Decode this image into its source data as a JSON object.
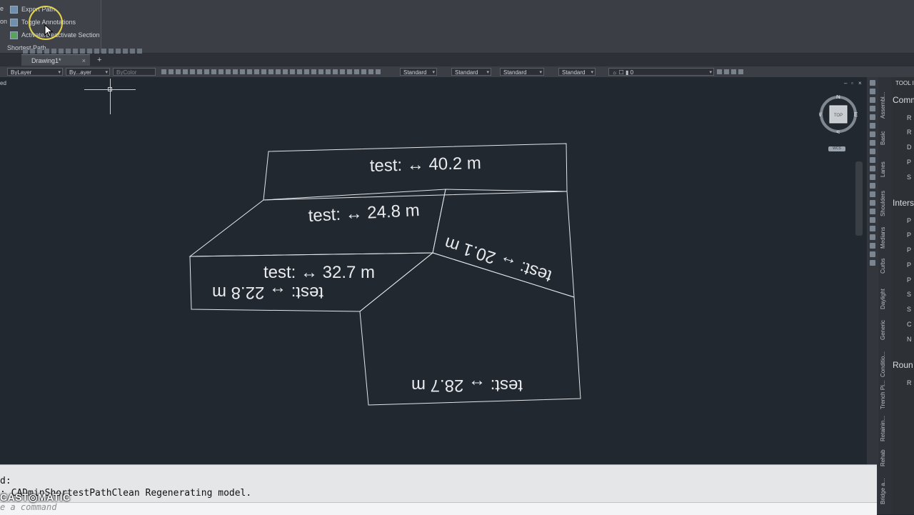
{
  "ribbon": {
    "items": [
      "Export Path",
      "Toggle Annotations",
      "Activate/Deactivate Section"
    ],
    "cut_labels": [
      "e",
      "on"
    ],
    "panel_title": "Shortest Path"
  },
  "tabs": {
    "document": "Drawing1*",
    "close": "×",
    "new": "+"
  },
  "properties": {
    "linetype": "ByLayer",
    "lineweight": "By...ayer",
    "plotstyle": "ByColor",
    "text_style": "Standard",
    "dim_style": "Standard",
    "table_style": "Standard",
    "mleader_style": "Standard",
    "layer": "0"
  },
  "viewport": {
    "controls": "ed",
    "window_buttons": [
      "–",
      "▫",
      "×"
    ],
    "viewcube": {
      "top": "TOP",
      "north": "N",
      "south": "S",
      "east": "E",
      "west": "W",
      "ucs": "WCS"
    }
  },
  "drawing": {
    "labels": [
      "test: ↔ 40.2 m",
      "test: ↔ 24.8 m",
      "test: ↔ 20.1 m",
      "test: ↔ 32.7 m",
      "test: ↔ 22.8 m",
      "test: ↔ 28.7 m"
    ]
  },
  "palette": {
    "title": "TOOL I",
    "tabs": [
      "Assembl...",
      "Basic",
      "Lanes",
      "Shoulders",
      "Medians",
      "Curbs",
      "Daylight",
      "Generic",
      "Conditio...",
      "Trench Pi...",
      "Retainin...",
      "Rehab",
      "Bridge a..."
    ],
    "section1": "Comm",
    "section1_items": [
      "R",
      "R",
      "D",
      "P",
      "S"
    ],
    "section2": "Inters",
    "section2_items": [
      "P",
      "P",
      "P",
      "P",
      "P",
      "S",
      "S",
      "C",
      "N"
    ],
    "section3": "Roun",
    "section3_items": [
      "R"
    ]
  },
  "command": {
    "line1": "d:",
    "line2": ": CADminShortestPathClean Regenerating model.",
    "placeholder": "e a command"
  },
  "watermark": "CAST◎MATIC",
  "colors": {
    "canvas": "#212830",
    "linework": "#e3e6ea",
    "ribbon": "#3b3f45",
    "command": "#e4e6e8"
  }
}
